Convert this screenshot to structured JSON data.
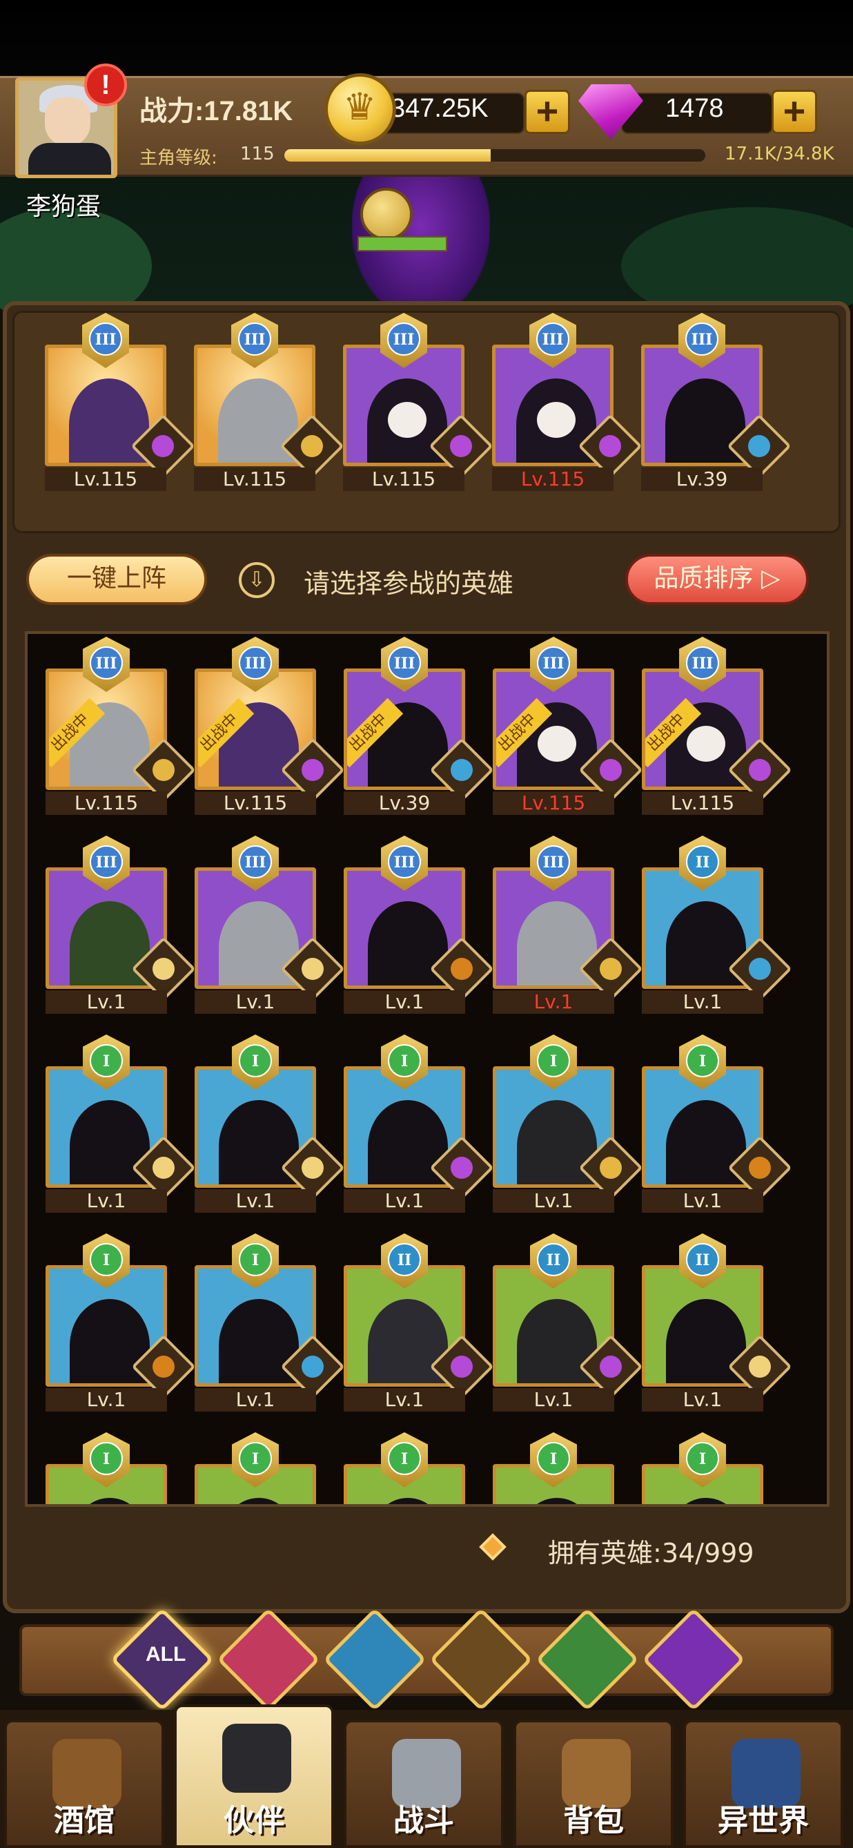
{
  "player": {
    "name": "李狗蛋",
    "alert_glyph": "!",
    "power": "战力:17.81K",
    "level_label": "主角等级:",
    "level": "115",
    "xp_text": "17.1K/34.8K",
    "xp_fraction": 0.49
  },
  "currency": {
    "gold": "347.25K",
    "gems": "1478",
    "plus": "+"
  },
  "team": [
    {
      "level": "Lv.115",
      "tier": "III",
      "bg": "gold",
      "hero": "orc",
      "faction": "demon",
      "level_red": false
    },
    {
      "level": "Lv.115",
      "tier": "III",
      "bg": "gold",
      "hero": "arm",
      "faction": "king",
      "level_red": false
    },
    {
      "level": "Lv.115",
      "tier": "III",
      "bg": "purple",
      "hero": "sk",
      "faction": "demon",
      "level_red": false
    },
    {
      "level": "Lv.115",
      "tier": "III",
      "bg": "purple",
      "hero": "sk",
      "faction": "demon",
      "level_red": true
    },
    {
      "level": "Lv.39",
      "tier": "III",
      "bg": "purple",
      "hero": "k",
      "faction": "fish",
      "level_red": false
    }
  ],
  "actions": {
    "auto_deploy": "一键上阵",
    "prompt": "请选择参战的英雄",
    "sort": "品质排序 ▷",
    "down_glyph": "⇩"
  },
  "deployed_label": "出战中",
  "heroes": [
    {
      "level": "Lv.115",
      "tier": "III",
      "bg": "gold",
      "hero": "arm",
      "faction": "king",
      "deployed": true,
      "level_red": false
    },
    {
      "level": "Lv.115",
      "tier": "III",
      "bg": "gold",
      "hero": "orc",
      "faction": "demon",
      "deployed": true,
      "level_red": false
    },
    {
      "level": "Lv.39",
      "tier": "III",
      "bg": "purple",
      "hero": "k",
      "faction": "fish",
      "deployed": true,
      "level_red": false
    },
    {
      "level": "Lv.115",
      "tier": "III",
      "bg": "purple",
      "hero": "sk",
      "faction": "demon",
      "deployed": true,
      "level_red": true
    },
    {
      "level": "Lv.115",
      "tier": "III",
      "bg": "purple",
      "hero": "sk",
      "faction": "demon",
      "deployed": true,
      "level_red": false
    },
    {
      "level": "Lv.1",
      "tier": "III",
      "bg": "purple",
      "hero": "hood",
      "faction": "elf",
      "deployed": false,
      "level_red": false
    },
    {
      "level": "Lv.1",
      "tier": "III",
      "bg": "purple",
      "hero": "arm",
      "faction": "elf",
      "deployed": false,
      "level_red": false
    },
    {
      "level": "Lv.1",
      "tier": "III",
      "bg": "purple",
      "hero": "k",
      "faction": "lion",
      "deployed": false,
      "level_red": false
    },
    {
      "level": "Lv.1",
      "tier": "III",
      "bg": "purple",
      "hero": "arm",
      "faction": "king",
      "deployed": false,
      "level_red": true
    },
    {
      "level": "Lv.1",
      "tier": "II",
      "bg": "blue",
      "hero": "k",
      "faction": "fish",
      "deployed": false,
      "level_red": false
    },
    {
      "level": "Lv.1",
      "tier": "I",
      "bg": "blue",
      "hero": "k",
      "faction": "elf",
      "deployed": false,
      "level_red": false
    },
    {
      "level": "Lv.1",
      "tier": "I",
      "bg": "blue",
      "hero": "k",
      "faction": "elf",
      "deployed": false,
      "level_red": false
    },
    {
      "level": "Lv.1",
      "tier": "I",
      "bg": "blue",
      "hero": "k",
      "faction": "demon",
      "deployed": false,
      "level_red": false
    },
    {
      "level": "Lv.1",
      "tier": "I",
      "bg": "blue",
      "hero": "hat",
      "faction": "king",
      "deployed": false,
      "level_red": false
    },
    {
      "level": "Lv.1",
      "tier": "I",
      "bg": "blue",
      "hero": "k",
      "faction": "lion",
      "deployed": false,
      "level_red": false
    },
    {
      "level": "Lv.1",
      "tier": "I",
      "bg": "blue",
      "hero": "k",
      "faction": "lion",
      "deployed": false,
      "level_red": false
    },
    {
      "level": "Lv.1",
      "tier": "I",
      "bg": "blue",
      "hero": "k",
      "faction": "fish",
      "deployed": false,
      "level_red": false
    },
    {
      "level": "Lv.1",
      "tier": "II",
      "bg": "green",
      "hero": "ice",
      "faction": "demon",
      "deployed": false,
      "level_red": false
    },
    {
      "level": "Lv.1",
      "tier": "II",
      "bg": "green",
      "hero": "hat",
      "faction": "demon",
      "deployed": false,
      "level_red": false
    },
    {
      "level": "Lv.1",
      "tier": "II",
      "bg": "green",
      "hero": "k",
      "faction": "elf",
      "deployed": false,
      "level_red": false
    },
    {
      "level": "",
      "tier": "I",
      "bg": "green",
      "hero": "k",
      "faction": "",
      "deployed": false,
      "level_red": false
    },
    {
      "level": "",
      "tier": "I",
      "bg": "green",
      "hero": "k",
      "faction": "",
      "deployed": false,
      "level_red": false
    },
    {
      "level": "",
      "tier": "I",
      "bg": "green",
      "hero": "k",
      "faction": "",
      "deployed": false,
      "level_red": false
    },
    {
      "level": "",
      "tier": "I",
      "bg": "green",
      "hero": "k",
      "faction": "",
      "deployed": false,
      "level_red": false
    },
    {
      "level": "",
      "tier": "I",
      "bg": "green",
      "hero": "k",
      "faction": "",
      "deployed": false,
      "level_red": false
    }
  ],
  "owned": {
    "label": "拥有英雄:",
    "count": "34/999"
  },
  "filters": [
    {
      "name": "all",
      "label": "ALL",
      "color": "#4b2f6a"
    },
    {
      "name": "king",
      "label": "",
      "color": "#c23a5e"
    },
    {
      "name": "fish",
      "label": "",
      "color": "#2f86b8"
    },
    {
      "name": "lion",
      "label": "",
      "color": "#6a4a1e"
    },
    {
      "name": "elf",
      "label": "",
      "color": "#3c8a3a"
    },
    {
      "name": "demon",
      "label": "",
      "color": "#7a2fb0"
    }
  ],
  "nav": [
    {
      "name": "tavern",
      "label": "酒馆",
      "color": "#8a5a28",
      "active": false
    },
    {
      "name": "partner",
      "label": "伙伴",
      "color": "#2a2a2e",
      "active": true
    },
    {
      "name": "battle",
      "label": "战斗",
      "color": "#9aa0a8",
      "active": false
    },
    {
      "name": "bag",
      "label": "背包",
      "color": "#9a6a32",
      "active": false
    },
    {
      "name": "otherworld",
      "label": "异世界",
      "color": "#2c4f8a",
      "active": false
    }
  ]
}
